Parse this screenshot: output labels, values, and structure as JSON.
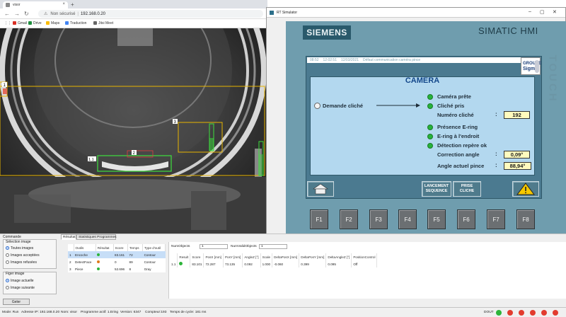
{
  "browser": {
    "tab_title": "visor",
    "url_warning": "Non sécurisé",
    "url": "192.168.0.20",
    "bookmarks": [
      "Gmail",
      "Drive",
      "Maps",
      "Traduction",
      "Jitsi Meet"
    ],
    "overlay_labels": [
      "1",
      "1.1",
      "2",
      "3"
    ]
  },
  "rt": {
    "title": "RT Simulator",
    "brand": "SIEMENS",
    "product": "SIMATIC HMI",
    "touch": "TOUCH",
    "alarm": {
      "time": "08:52",
      "time2": "12:02:51",
      "date": "12/03/2021",
      "text": "Défaut communication caméra pince"
    },
    "logo": {
      "line1": "GROUPE",
      "line2": "Sigma"
    },
    "camera": {
      "title": "CAMERA",
      "demande": "Demande cliché",
      "camera_prete": "Caméra prête",
      "cliche_pris": "Cliché pris",
      "numero_cliche_label": "Numéro cliché",
      "numero_cliche": "192",
      "presence_ering": "Présence E-ring",
      "ering_endroit": "E-ring à l'endroit",
      "detection": "Détection repère ok",
      "correction_label": "Correction angle",
      "correction": "0,09°",
      "angle_label": "Angle actuel pince",
      "angle": "88,94°"
    },
    "buttons": {
      "lancement": "LANCEMENT SEQUENCE",
      "prise": "PRISE CLICHE"
    },
    "fkeys": [
      "F1",
      "F2",
      "F3",
      "F4",
      "F5",
      "F6",
      "F7",
      "F8"
    ]
  },
  "app": {
    "commande": "Commande",
    "selection_title": "Sélection image",
    "selection": [
      "Toutes images",
      "Images acceptées",
      "Images refusées"
    ],
    "figer_title": "Figer image",
    "figer": [
      "Image actuelle",
      "Image suivante"
    ],
    "geler": "Geler",
    "tabs": [
      "Résultat",
      "Statistiques Programmes"
    ],
    "tool_headers": [
      "Outils",
      "Résultat",
      "Score",
      "Temps",
      "Type d'outil"
    ],
    "tools": [
      {
        "id": "1",
        "name": "Encoche",
        "led": "#2db43a",
        "score": "83.161",
        "temps": "72",
        "type": "Contour"
      },
      {
        "id": "2",
        "name": "DetectFace",
        "led": "#e07a1c",
        "score": "0",
        "temps": "89",
        "type": "Contour"
      },
      {
        "id": "3",
        "name": "Piece",
        "led": "#2db43a",
        "score": "52.696",
        "temps": "8",
        "type": "Gray"
      }
    ],
    "num_objects_label": "NumObjects",
    "num_objects": "1",
    "num_valid_label": "NumValidObjects",
    "num_valid": "1",
    "res_headers": [
      "",
      "Result",
      "Score",
      "PosX [mm]",
      "PosY [mm]",
      "AngleZ [°]",
      "Scale",
      "DeltaPosX [mm]",
      "DeltaPosY [mm]",
      "DeltaAngleZ [°]",
      "PositionControl"
    ],
    "res_row": [
      "1.1",
      "",
      "83.101",
      "72.287",
      "73.135",
      "0.092",
      "1.000",
      "-0.060",
      "0.399",
      "0.095",
      "Off"
    ]
  },
  "status": {
    "mode": "Mode: Run",
    "ip": "Adresse IP: 192.168.0.20",
    "nom": "Nom: visor",
    "programme": "Programme actif: 1.Ering",
    "version": "Version: 6347",
    "compteur": "Compteur:193",
    "temps": "Temps de cycle: 181 ms",
    "dout": "DOUT",
    "dout_colors": [
      "#2db43a",
      "#e23b2e",
      "#e23b2e",
      "#e23b2e",
      "#e23b2e",
      "#e23b2e",
      "#e23b2e"
    ]
  }
}
